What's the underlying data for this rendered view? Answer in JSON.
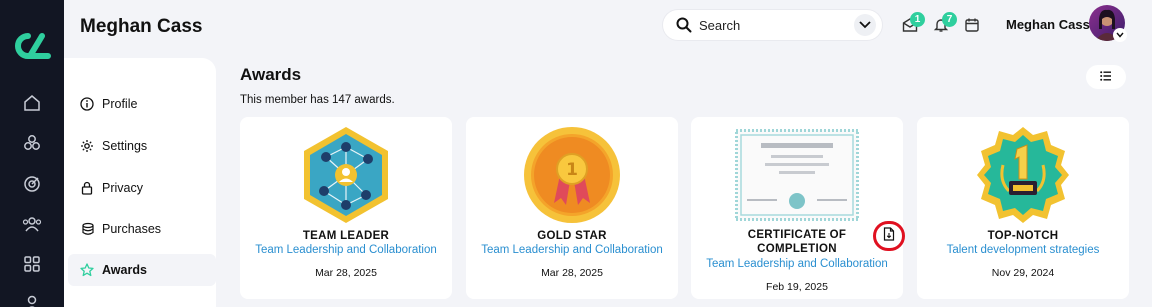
{
  "header": {
    "title": "Meghan Cass",
    "search": {
      "placeholder": "Search"
    },
    "notifications": {
      "messages_count": "1",
      "alerts_count": "7"
    },
    "user_name": "Meghan Cass"
  },
  "sidebar": {
    "items": [
      {
        "label": "Profile",
        "icon": "info-icon"
      },
      {
        "label": "Settings",
        "icon": "gear-icon"
      },
      {
        "label": "Privacy",
        "icon": "lock-icon"
      },
      {
        "label": "Purchases",
        "icon": "coins-icon"
      },
      {
        "label": "Awards",
        "icon": "star-icon",
        "active": true
      }
    ]
  },
  "main": {
    "title": "Awards",
    "subtitle": "This member has 147 awards.",
    "awards": [
      {
        "name": "TEAM LEADER",
        "course": "Team Leadership and Collaboration",
        "date": "Mar 28, 2025",
        "badge": "hexagon-network-badge"
      },
      {
        "name": "GOLD STAR",
        "course": "Team Leadership and Collaboration",
        "date": "Mar 28, 2025",
        "badge": "gold-medal-badge"
      },
      {
        "name": "CERTIFICATE OF",
        "name2": "COMPLETION",
        "course": "Team Leadership and Collaboration",
        "date": "Feb 19, 2025",
        "badge": "certificate-badge"
      },
      {
        "name": "TOP-NOTCH",
        "course": "Talent development strategies",
        "date": "Nov 29, 2024",
        "badge": "number-one-badge"
      }
    ]
  },
  "colors": {
    "rail": "#121623",
    "accent": "#2fcf9e",
    "link": "#2a8fd0",
    "highlight": "#e01020"
  }
}
